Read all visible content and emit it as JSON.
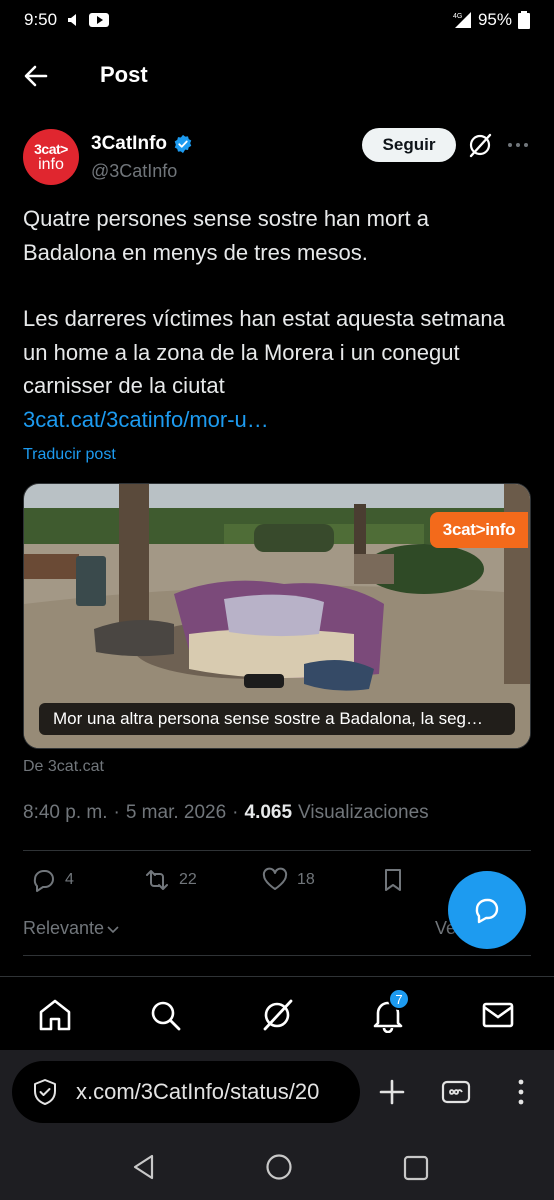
{
  "status_bar": {
    "time": "9:50",
    "network": "4G",
    "battery": "95%"
  },
  "header": {
    "title": "Post"
  },
  "author": {
    "avatar_line1": "3cat>",
    "avatar_line2": "info",
    "name": "3CatInfo",
    "handle": "@3CatInfo",
    "follow_label": "Seguir"
  },
  "post": {
    "paragraph1": "Quatre persones sense sostre han mort a Badalona en menys de tres mesos.",
    "paragraph2": "Les darreres víctimes han estat aquesta setmana un home a la zona de la Morera i un conegut carnisser de la ciutat",
    "link": "3cat.cat/3catinfo/mor-u…",
    "translate_label": "Traducir post"
  },
  "media": {
    "logo_text": "3cat>info",
    "caption": "Mor una altra persona sense sostre a Badalona, la seg…",
    "source": "De 3cat.cat"
  },
  "meta": {
    "time": "8:40 p. m.",
    "sep1": "·",
    "date": "5 mar. 2026",
    "sep2": "·",
    "views_count": "4.065",
    "views_label": "Visualizaciones"
  },
  "actions": {
    "replies": "4",
    "reposts": "22",
    "likes": "18"
  },
  "replies_filter": {
    "label": "Relevante",
    "right_partial": "Ve"
  },
  "nav": {
    "notifications_badge": "7"
  },
  "browser": {
    "url": "x.com/3CatInfo/status/20"
  },
  "colors": {
    "accent": "#1d9bf0",
    "brand_red": "#e0262f",
    "brand_orange": "#f36a1b"
  }
}
